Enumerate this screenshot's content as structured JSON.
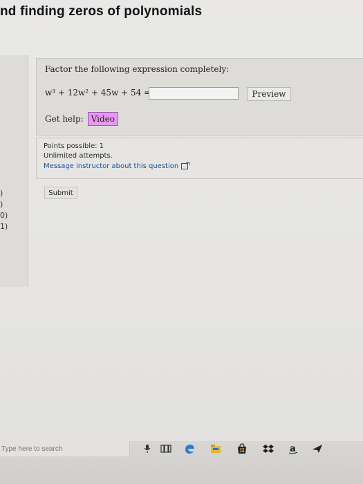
{
  "header": {
    "title": "nd finding zeros of polynomials"
  },
  "left_panel": {
    "items": [
      ")",
      ")",
      "0)",
      "1)"
    ]
  },
  "question": {
    "prompt": "Factor the following expression completely:",
    "expression": "w³ + 12w² + 45w + 54 =",
    "answer_value": "",
    "preview_label": "Preview",
    "get_help_label": "Get help:",
    "video_label": "Video"
  },
  "points": {
    "possible": "Points possible: 1",
    "attempts": "Unlimited attempts.",
    "message_link": "Message instructor about this question"
  },
  "submit_label": "Submit",
  "taskbar": {
    "search_placeholder": "Type here to search",
    "apps": [
      "microphone-icon",
      "task-view-icon",
      "edge-icon",
      "file-explorer-icon",
      "store-icon",
      "dropbox-icon",
      "amazon-icon",
      "send-icon"
    ]
  },
  "colors": {
    "video_button_bg": "#e79aed",
    "link": "#1d4e96",
    "edge_blue": "#2b7bd4"
  }
}
